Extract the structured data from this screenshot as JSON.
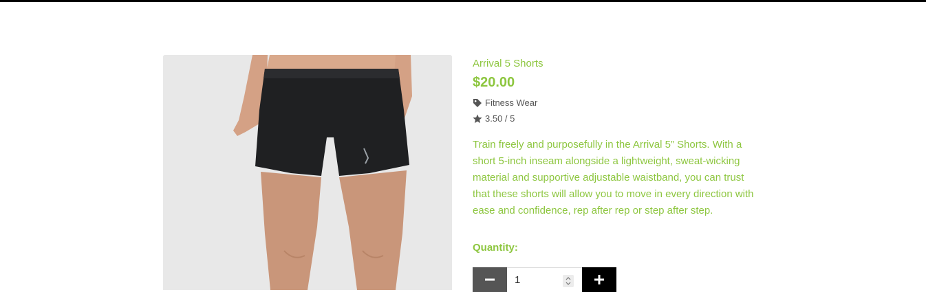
{
  "product": {
    "title": "Arrival 5 Shorts",
    "price": "$20.00",
    "category": "Fitness Wear",
    "rating": "3.50 / 5",
    "description": "Train freely and purposefully in the Arrival 5” Shorts. With a short 5-inch inseam alongside a lightweight, sweat-wicking material and supportive adjustable waistband, you can trust that these shorts will allow you to move in every direction with ease and confidence, rep after rep or step after step.",
    "image_icon": "product-photo-black-shorts"
  },
  "quantity": {
    "label": "Quantity:",
    "value": "1",
    "minus_icon": "minus-icon",
    "plus_icon": "plus-icon"
  },
  "icons": {
    "category": "tag-icon",
    "rating": "star-icon"
  },
  "colors": {
    "accent": "#8dc63f",
    "meta_text": "#555555",
    "minus_button": "#555555",
    "plus_button": "#000000",
    "image_bg": "#e8e8e8"
  }
}
